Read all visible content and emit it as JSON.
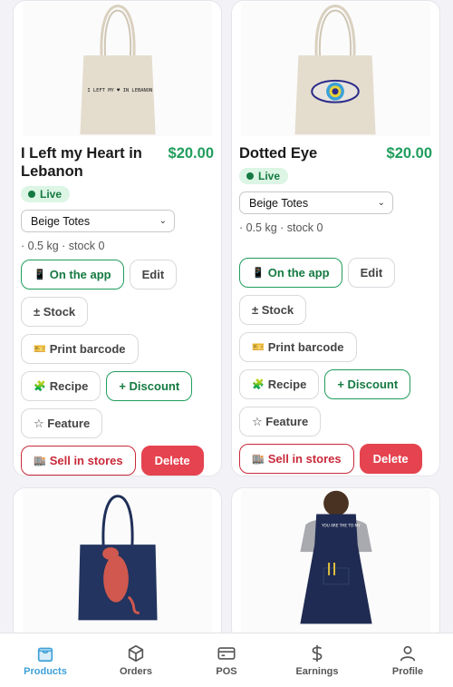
{
  "products": [
    {
      "title": "I Left my Heart in Lebanon",
      "price": "$20.00",
      "status": "Live",
      "category": "Beige Totes",
      "meta": "· 0.5 kg · stock 0",
      "tote_print": "I LEFT MY ♥ IN LEBANON"
    },
    {
      "title": "Dotted Eye",
      "price": "$20.00",
      "status": "Live",
      "category": "Beige Totes",
      "meta": "· 0.5 kg · stock 0"
    }
  ],
  "actions": {
    "on_app": "On the app",
    "edit": "Edit",
    "stock": "± Stock",
    "print_barcode": "Print barcode",
    "recipe": "Recipe",
    "discount": "+ Discount",
    "feature": "☆ Feature",
    "sell_in_stores": "Sell in stores",
    "delete": "Delete"
  },
  "apron_text": "YOU ARE THE TO MY",
  "nav": {
    "items": [
      {
        "label": "Products",
        "icon": "bag-icon",
        "active": true
      },
      {
        "label": "Orders",
        "icon": "box-icon"
      },
      {
        "label": "POS",
        "icon": "card-icon"
      },
      {
        "label": "Earnings",
        "icon": "dollar-icon"
      },
      {
        "label": "Profile",
        "icon": "person-icon"
      }
    ]
  },
  "colors": {
    "price_green": "#1f9d5c",
    "live_bg": "#dcf5e5",
    "delete_red": "#e5434f",
    "active_nav": "#3ca0d8"
  }
}
